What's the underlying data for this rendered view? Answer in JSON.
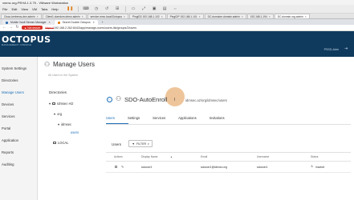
{
  "vmware": {
    "title": "xmmc.org-PEHA 1.3.75 - VMware Workstation",
    "menu": [
      "File",
      "Edit",
      "View",
      "VM",
      "Tabs",
      "Help"
    ],
    "tabs": [
      {
        "label": "Cisco-kerberos-dev-admin",
        "active": false
      },
      {
        "label": "Client1.domdom.demo.admin",
        "active": false
      },
      {
        "label": "service.mmc.local/Octopus",
        "active": false
      },
      {
        "label": "PingID2 192.168.1.102",
        "active": false
      },
      {
        "label": "PingIDP 192.168.1.101",
        "active": false
      },
      {
        "label": "DC.domdom.domain.admin",
        "active": false
      },
      {
        "label": "192.168.1.194",
        "active": false
      },
      {
        "label": "DC.domain.org.admin",
        "active": true
      }
    ]
  },
  "browser": {
    "tabs": [
      {
        "label": "Mobile Vault Stream Manager",
        "active": false
      },
      {
        "label": "Secret Double Octopus",
        "active": true
      }
    ],
    "not_secure": "Not secure",
    "url_scheme": "https://",
    "url_rest": "192.168.2.262:8443/app/manage-users/users-list/groups/2/users"
  },
  "header": {
    "logo": "OCTOPUS",
    "logo_sub": "MANAGEMENT CONSOLE",
    "user": "PSSD-Adm"
  },
  "nav": {
    "items": [
      {
        "label": "System Settings",
        "active": false
      },
      {
        "label": "Directories",
        "active": false
      },
      {
        "label": "Manage Users",
        "active": true
      },
      {
        "label": "Devices",
        "active": false
      },
      {
        "label": "Services",
        "active": false
      },
      {
        "label": "Portal",
        "active": false
      },
      {
        "label": "Application",
        "active": false
      },
      {
        "label": "Reports",
        "active": false
      },
      {
        "label": "Auditing",
        "active": false
      }
    ]
  },
  "page": {
    "title": "Manage Users",
    "subtitle": "All Users in the System"
  },
  "directories": {
    "title": "Directories",
    "tree": [
      {
        "label": "Idmsec-AD",
        "expander": "▾",
        "folder": true
      },
      {
        "label": "org",
        "expander": "▾",
        "folder": false
      },
      {
        "label": "idmsec",
        "expander": "▾",
        "folder": false
      },
      {
        "label": "users",
        "expander": "",
        "folder": false,
        "selected": true
      },
      {
        "label": "LOCAL",
        "expander": "",
        "folder": true
      }
    ]
  },
  "group": {
    "name": "SDO-AutoEnroll",
    "path": "idmsec.az/org/idmsec/users",
    "cursor_glyph": "I"
  },
  "tabs": [
    {
      "label": "Users",
      "active": true
    },
    {
      "label": "Settings",
      "active": false
    },
    {
      "label": "Services",
      "active": false
    },
    {
      "label": "Applications",
      "active": false
    },
    {
      "label": "Invitations",
      "active": false
    }
  ],
  "users_section": {
    "label": "Users",
    "filter_label": "FILTER",
    "columns": [
      "Actions",
      "Display Name",
      "Email",
      "Username",
      "Status"
    ],
    "rows": [
      {
        "display_name": "sdouser1",
        "email": "sdouser1@idmsec.org",
        "username": "sdouser1",
        "status": "Inactive"
      }
    ]
  },
  "icons": {
    "back": "arrow-left-icon",
    "group": "users-icon",
    "manage_users": "users-icon",
    "filter": "filter-icon",
    "edit": "pencil-icon",
    "status": "user-icon"
  },
  "colors": {
    "header_bg": "#0f3a5d",
    "accent": "#1d6fb8",
    "not_secure": "#d93025",
    "cursor_highlight": "#e8b279"
  }
}
